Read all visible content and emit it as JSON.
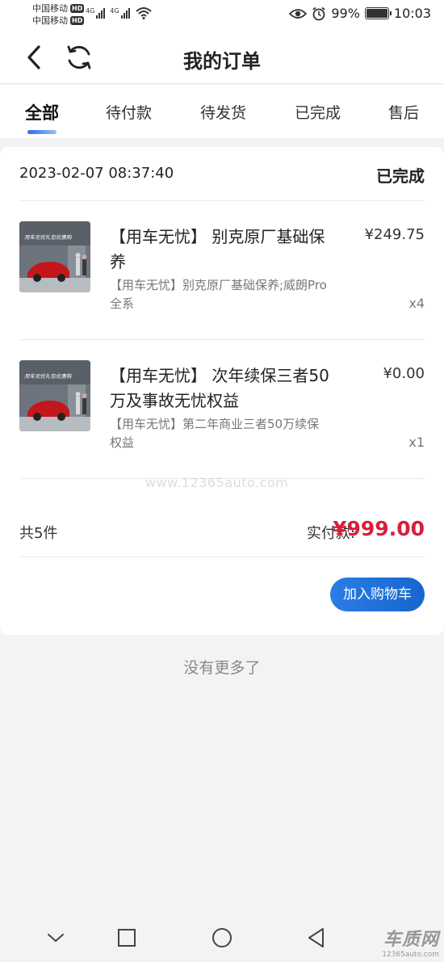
{
  "status_bar": {
    "carrier1": "中国移动",
    "carrier2": "中国移动",
    "hd": "HD",
    "network1": "4G",
    "network2": "4G",
    "battery_text": "99%",
    "battery_level": 0.99,
    "time": "10:03"
  },
  "header": {
    "title": "我的订单"
  },
  "tabs": [
    {
      "label": "全部",
      "active": true
    },
    {
      "label": "待付款",
      "active": false
    },
    {
      "label": "待发货",
      "active": false
    },
    {
      "label": "已完成",
      "active": false
    },
    {
      "label": "售后",
      "active": false
    }
  ],
  "order": {
    "time": "2023-02-07 08:37:40",
    "status": "已完成",
    "items": [
      {
        "title": "【用车无忧】 别克原厂基础保养",
        "desc": "【用车无忧】别克原厂基础保养;威朗Pro全系",
        "price": "¥249.75",
        "qty": "x4",
        "thumb_text": "用车无忧礼包优惠购"
      },
      {
        "title": "【用车无忧】 次年续保三者50万及事故无忧权益",
        "desc": "【用车无忧】第二年商业三者50万续保权益",
        "price": "¥0.00",
        "qty": "x1",
        "thumb_text": "用车无忧礼包优惠购"
      }
    ],
    "total_count": "共5件",
    "paid_label": "实付款:",
    "paid_amount": "¥999.00",
    "add_cart_label": "加入购物车"
  },
  "footer": {
    "no_more": "没有更多了"
  },
  "watermark": "www.12365auto.com",
  "corner_logo": {
    "big": "车质网",
    "small": "12365auto.com"
  },
  "colors": {
    "accent": "#1e6fdc",
    "price_red": "#d81e3c",
    "background": "#f2f3f5"
  }
}
